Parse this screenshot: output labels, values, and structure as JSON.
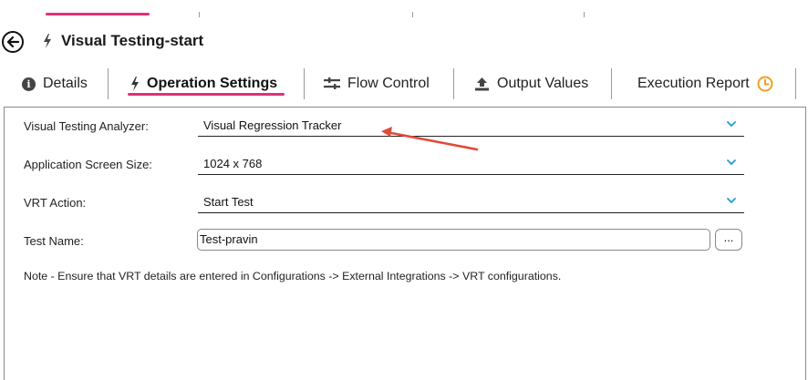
{
  "header": {
    "title": "Visual Testing-start"
  },
  "tabs": [
    {
      "label": "Details"
    },
    {
      "label": "Operation Settings"
    },
    {
      "label": "Flow Control"
    },
    {
      "label": "Output Values"
    },
    {
      "label": "Execution Report"
    }
  ],
  "form": {
    "analyzer_label": "Visual Testing Analyzer:",
    "analyzer_value": "Visual Regression Tracker",
    "screen_label": "Application Screen Size:",
    "screen_value": "1024 x 768",
    "action_label": "VRT Action:",
    "action_value": "Start Test",
    "testname_label": "Test Name:",
    "testname_value": "Test-pravin",
    "browse_label": "...",
    "note": "Note - Ensure that VRT details are entered in Configurations -> External Integrations -> VRT configurations."
  },
  "colors": {
    "accent": "#e0307a",
    "chevron": "#1a9bd7",
    "clock": "#f0a020",
    "arrow": "#e04a3a"
  },
  "icons": [
    "back-arrow-icon",
    "bolt-icon",
    "info-icon",
    "flow-control-icon",
    "upload-icon",
    "clock-icon",
    "chevron-down-icon"
  ]
}
